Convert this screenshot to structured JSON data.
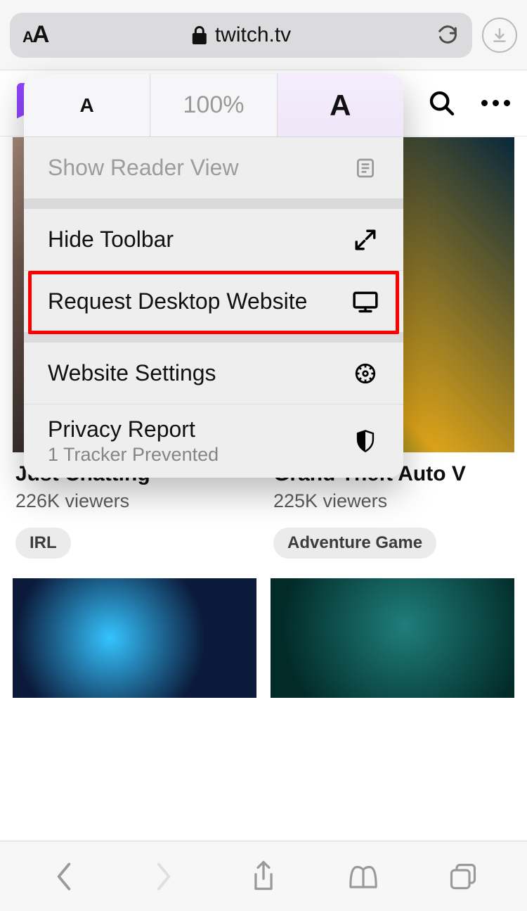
{
  "address_bar": {
    "aa_small": "A",
    "aa_big": "A",
    "url": "twitch.tv"
  },
  "page_header": {},
  "popover": {
    "zoom": {
      "small": "A",
      "percent": "100%",
      "big": "A"
    },
    "reader": "Show Reader View",
    "items": [
      {
        "label": "Hide Toolbar",
        "icon": "expand"
      },
      {
        "label": "Request Desktop Website",
        "icon": "monitor"
      },
      {
        "label": "Website Settings",
        "icon": "gear"
      },
      {
        "label": "Privacy Report",
        "sublabel": "1 Tracker Prevented",
        "icon": "shield"
      }
    ]
  },
  "cards": [
    {
      "title": "Just Chatting",
      "viewers": "226K viewers",
      "tag": "IRL"
    },
    {
      "title": "Grand Theft Auto V",
      "viewers": "225K viewers",
      "tag": "Adventure Game"
    }
  ]
}
